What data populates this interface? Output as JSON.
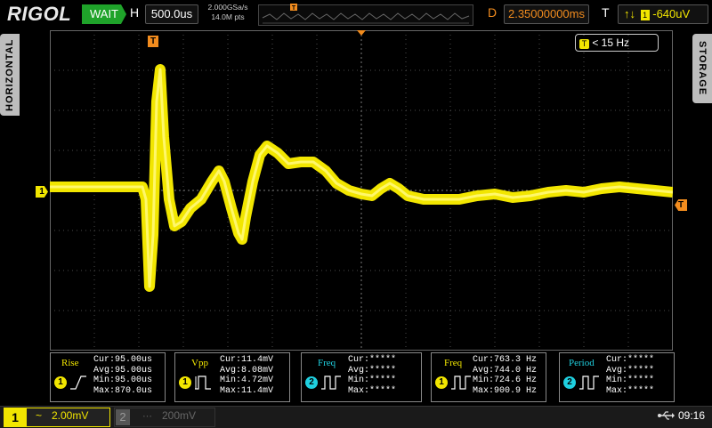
{
  "brand": {
    "logo": "RIGOL"
  },
  "run_status": "WAIT",
  "horizontal": {
    "label": "H",
    "timebase": "500.0us",
    "sample_rate": "2.000GSa/s",
    "memory_depth": "14.0M pts"
  },
  "delay": {
    "label": "D",
    "value": "2.35000000ms"
  },
  "trigger": {
    "label": "T",
    "level": "-640uV",
    "frequency": "< 15 Hz",
    "marker": "T"
  },
  "side_tabs": {
    "left": "HORIZONTAL",
    "right": "STORAGE"
  },
  "channel_marker": "1",
  "measurements": [
    {
      "name": "Rise",
      "channel": "1",
      "cur": "Cur:95.00us",
      "avg": "Avg:95.00us",
      "min": "Min:95.00us",
      "max": "Max:870.0us"
    },
    {
      "name": "Vpp",
      "channel": "1",
      "cur": "Cur:11.4mV",
      "avg": "Avg:8.08mV",
      "min": "Min:4.72mV",
      "max": "Max:11.4mV"
    },
    {
      "name": "Freq",
      "channel": "2",
      "cur": "Cur:*****",
      "avg": "Avg:*****",
      "min": "Min:*****",
      "max": "Max:*****"
    },
    {
      "name": "Freq",
      "channel": "1",
      "cur": "Cur:763.3 Hz",
      "avg": "Avg:744.0 Hz",
      "min": "Min:724.6 Hz",
      "max": "Max:900.9 Hz"
    },
    {
      "name": "Period",
      "channel": "2",
      "cur": "Cur:*****",
      "avg": "Avg:*****",
      "min": "Min:*****",
      "max": "Max:*****"
    }
  ],
  "channels": {
    "ch1": {
      "num": "1",
      "coupling": "~",
      "scale": "2.00mV"
    },
    "ch2": {
      "num": "2",
      "coupling": "⋯",
      "scale": "200mV"
    }
  },
  "clock": "09:16",
  "colors": {
    "ch1": "#f2e600",
    "ch2": "#1fd0e0",
    "trigger": "#f28c1e",
    "run": "#1fa32a"
  },
  "icons": {
    "usb": "usb-icon"
  }
}
